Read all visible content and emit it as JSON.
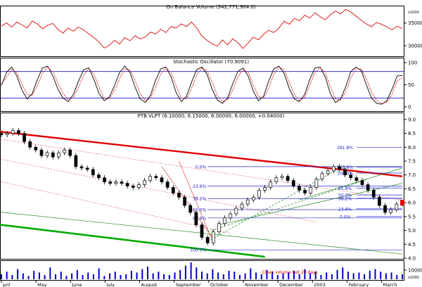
{
  "chart_data": [
    {
      "type": "line",
      "title": "On Balance Volume (342,771,904.0)",
      "y_ticks": [
        "35000",
        "30000"
      ],
      "y_unit_label": "x1000",
      "ylim": [
        28000,
        38500
      ],
      "series": [
        {
          "values": [
            34300,
            35000,
            34100,
            35200,
            34600,
            33900,
            35400,
            34800,
            33700,
            34500,
            34900,
            33600,
            32800,
            33900,
            33200,
            34100,
            33500,
            32600,
            31800,
            30800,
            29500,
            30100,
            31200,
            30400,
            31800,
            31100,
            32200,
            31500,
            31900,
            33000,
            32600,
            33600,
            32900,
            34200,
            33900,
            34800,
            34200,
            35200,
            33900,
            32100,
            31200,
            30400,
            29900,
            31300,
            30200,
            31500,
            30700,
            29400,
            30600,
            31900,
            31300,
            32500,
            33400,
            32900,
            33900,
            35400,
            34700,
            36000,
            35500,
            36700,
            36100,
            37200,
            36400,
            35700,
            36800,
            37600,
            37000,
            38000,
            37400,
            36500,
            35600,
            34800,
            34200,
            35100,
            34700,
            34100,
            33500,
            34300,
            33800
          ]
        }
      ]
    },
    {
      "type": "line",
      "title": "Stochastic Oscillator (70.9091)",
      "y_ticks": [
        "100",
        "50",
        "0"
      ],
      "ylim": [
        -8,
        108
      ],
      "bands": [
        20,
        80
      ],
      "series": [
        {
          "values": [
            48,
            78,
            90,
            70,
            38,
            18,
            30,
            62,
            88,
            92,
            70,
            40,
            20,
            12,
            28,
            58,
            84,
            88,
            62,
            30,
            14,
            22,
            48,
            78,
            92,
            78,
            45,
            18,
            10,
            26,
            60,
            86,
            90,
            68,
            32,
            12,
            24,
            56,
            84,
            90,
            74,
            40,
            16,
            8,
            20,
            52,
            80,
            88,
            70,
            36,
            14,
            24,
            58,
            86,
            92,
            76,
            42,
            18,
            12,
            28,
            62,
            88,
            90,
            68,
            30,
            10,
            18,
            46,
            80,
            90,
            82,
            50,
            20,
            8,
            6,
            14,
            40,
            70,
            71
          ]
        },
        {
          "values": [
            52,
            66,
            84,
            78,
            52,
            28,
            26,
            48,
            76,
            90,
            80,
            54,
            30,
            16,
            22,
            44,
            72,
            86,
            74,
            44,
            20,
            18,
            36,
            64,
            86,
            84,
            60,
            30,
            14,
            20,
            44,
            74,
            88,
            78,
            48,
            20,
            18,
            42,
            72,
            88,
            82,
            56,
            26,
            12,
            16,
            38,
            68,
            84,
            78,
            50,
            24,
            20,
            42,
            74,
            90,
            84,
            56,
            28,
            14,
            22,
            48,
            78,
            88,
            78,
            46,
            18,
            16,
            34,
            66,
            86,
            86,
            64,
            34,
            14,
            8,
            10,
            28,
            58,
            66
          ]
        }
      ]
    },
    {
      "type": "candlestick",
      "title": "PTB VLPT (6.10000, 6.15000, 6.00000, 6.00000, +0.04000)",
      "y_ticks": [
        "9.0",
        "8.5",
        "8.0",
        "7.5",
        "7.0",
        "6.5",
        "6.0",
        "5.5",
        "5.0",
        "4.5",
        "4.0"
      ],
      "ylim": [
        4.0,
        9.2
      ],
      "x_labels": [
        "pril",
        "May",
        "June",
        "July",
        "August",
        "September",
        "October",
        "November",
        "December",
        "2003",
        "February",
        "March"
      ],
      "close": [
        8.45,
        8.5,
        8.6,
        8.5,
        8.2,
        8.0,
        7.9,
        7.7,
        7.8,
        7.65,
        7.8,
        7.9,
        7.7,
        7.3,
        7.25,
        7.2,
        7.0,
        6.9,
        6.75,
        6.7,
        6.75,
        6.7,
        6.6,
        6.55,
        6.65,
        6.8,
        6.95,
        6.9,
        6.75,
        6.55,
        6.35,
        6.2,
        5.9,
        5.65,
        5.2,
        4.75,
        4.55,
        4.95,
        5.25,
        5.45,
        5.6,
        5.8,
        5.95,
        6.1,
        6.2,
        6.45,
        6.55,
        6.75,
        6.9,
        6.95,
        6.8,
        6.6,
        6.45,
        6.35,
        6.55,
        6.85,
        7.05,
        7.15,
        7.3,
        7.2,
        7.0,
        6.9,
        6.8,
        6.65,
        6.45,
        6.2,
        5.9,
        5.65,
        5.75,
        5.95,
        6.0
      ],
      "fibonacci_upper": [
        {
          "label": "261.8%",
          "value": 8.0
        },
        {
          "label": "161.8%",
          "value": 7.28
        },
        {
          "label": "100.0%",
          "value": 7.07
        },
        {
          "label": "61.8%",
          "value": 6.53
        },
        {
          "label": "50.0%",
          "value": 6.28
        },
        {
          "label": "38.2%",
          "value": 6.16
        },
        {
          "label": "23.6%",
          "value": 5.78
        },
        {
          "label": "0.0%",
          "value": 5.5
        }
      ],
      "fibonacci_lower": [
        {
          "label": "0.0%",
          "value": 7.3
        },
        {
          "label": "23.6%",
          "value": 6.6
        },
        {
          "label": "38.2%",
          "value": 6.15
        },
        {
          "label": "50.0%",
          "value": 5.75
        },
        {
          "label": "61.8%",
          "value": 5.45
        },
        {
          "label": "100.0%",
          "value": 4.3
        }
      ]
    },
    {
      "type": "bar",
      "y_ticks": [
        "10000"
      ],
      "y_unit_label": "x1000",
      "annotation": "Clean volume last 20 days",
      "volume_color": "#0000cc",
      "volume": [
        6,
        9,
        5,
        12,
        7,
        4,
        10,
        8,
        5,
        14,
        6,
        9,
        4,
        7,
        11,
        5,
        8,
        6,
        13,
        4,
        7,
        9,
        5,
        6,
        10,
        8,
        12,
        15,
        7,
        9,
        6,
        5,
        8,
        11,
        16,
        20,
        14,
        9,
        7,
        12,
        8,
        6,
        10,
        9,
        5,
        7,
        13,
        8,
        6,
        11,
        9,
        5,
        7,
        8,
        10,
        6,
        12,
        7,
        9,
        5,
        8,
        6,
        11,
        14,
        9,
        7,
        8,
        6,
        10,
        12,
        9,
        7,
        8,
        5,
        6
      ]
    }
  ]
}
